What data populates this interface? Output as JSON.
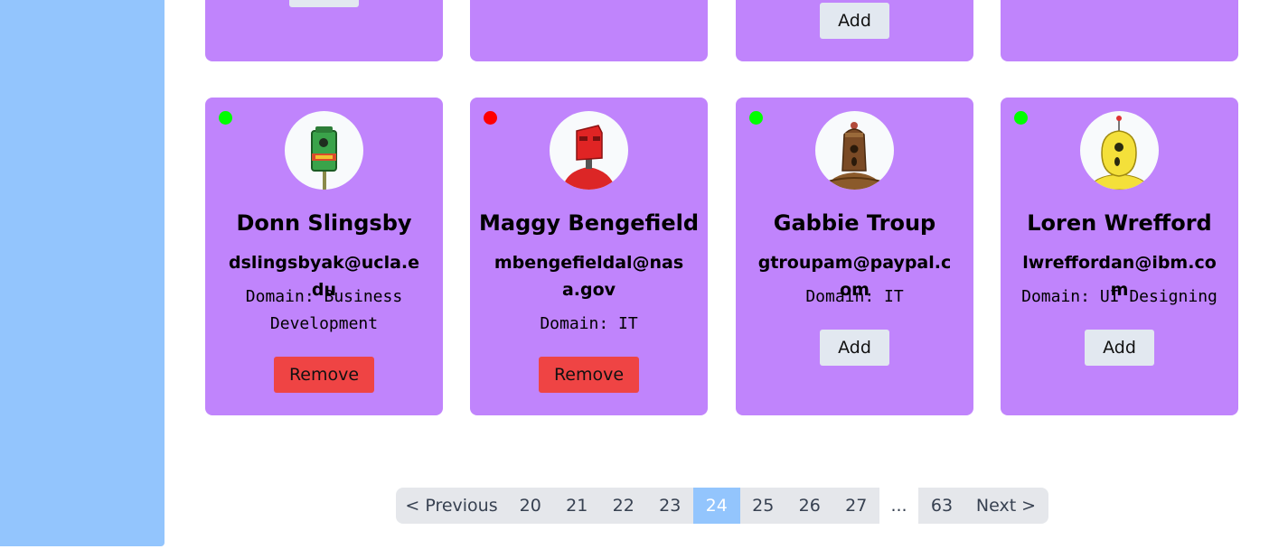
{
  "colors": {
    "sidebar": "#93c5fd",
    "card": "#c084fc",
    "online": "#00ff00",
    "offline": "#ff0000",
    "remove_button": "#ef4444",
    "add_button": "#e2e8f0",
    "pagination_active": "#93c5fd"
  },
  "top_row": {
    "cards": [
      {
        "button_label": ""
      },
      {
        "button_label": ""
      },
      {
        "button_label": "Add"
      },
      {
        "button_label": ""
      }
    ]
  },
  "cards": [
    {
      "status": "online",
      "avatar_icon": "robot-avatar-green",
      "name": "Donn Slingsby",
      "email": "dslingsbyak@ucla.edu",
      "domain_line_1": "Domain: Business",
      "domain_line_2": "Development",
      "button_label": "Remove"
    },
    {
      "status": "offline",
      "avatar_icon": "robot-avatar-red",
      "name": "Maggy Bengefield",
      "email": "mbengefieldal@nasa.gov",
      "domain_line_1": "Domain: IT",
      "button_label": "Remove"
    },
    {
      "status": "online",
      "avatar_icon": "robot-avatar-brown",
      "name": "Gabbie Troup",
      "email": "gtroupam@paypal.com",
      "domain_line_1": "Domain: IT",
      "button_label": "Add"
    },
    {
      "status": "online",
      "avatar_icon": "robot-avatar-yellow",
      "name": "Loren Wrefford",
      "email": "lwreffordan@ibm.com",
      "domain_line_1": "Domain: UI Designing",
      "button_label": "Add"
    }
  ],
  "pagination": {
    "previous": "< Previous",
    "pages": [
      "20",
      "21",
      "22",
      "23",
      "24",
      "25",
      "26",
      "27"
    ],
    "current": "24",
    "break": "...",
    "last": "63",
    "next": "Next >"
  }
}
